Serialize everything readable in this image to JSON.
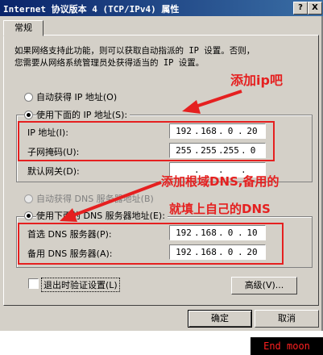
{
  "window": {
    "title": "Internet 协议版本 4 (TCP/IPv4) 属性",
    "help_btn": "?",
    "close_btn": "X"
  },
  "tabs": [
    {
      "label": "常规"
    }
  ],
  "description": {
    "line1": "如果网络支持此功能，则可以获取自动指派的 IP 设置。否则，",
    "line2": "您需要从网络系统管理员处获得适当的 IP 设置。"
  },
  "ip": {
    "auto_label": "自动获得 IP 地址(O)",
    "manual_label": "使用下面的 IP 地址(S):",
    "address_label": "IP 地址(I):",
    "address": [
      "192",
      "168",
      "0",
      "20"
    ],
    "subnet_label": "子网掩码(U):",
    "subnet": [
      "255",
      "255",
      "255",
      "0"
    ],
    "gateway_label": "默认网关(D):",
    "gateway": [
      "",
      "",
      "",
      ""
    ]
  },
  "dns": {
    "auto_label": "自动获得 DNS 服务器地址(B)",
    "manual_label": "使用下面的 DNS 服务器地址(E):",
    "preferred_label": "首选 DNS 服务器(P):",
    "preferred": [
      "192",
      "168",
      "0",
      "10"
    ],
    "alternate_label": "备用 DNS 服务器(A):",
    "alternate": [
      "192",
      "168",
      "0",
      "20"
    ]
  },
  "validate_label": "退出时验证设置(L)",
  "advanced_button": "高级(V)...",
  "ok_button": "确定",
  "cancel_button": "取消",
  "annotations": {
    "add_ip": "添加ip吧",
    "dns_line1": "添加根域DNS,备用的",
    "dns_line2": "就填上自己的DNS"
  },
  "watermark": "End moon",
  "colors": {
    "annotation": "#e52020",
    "titlebar": "#0a246a"
  }
}
